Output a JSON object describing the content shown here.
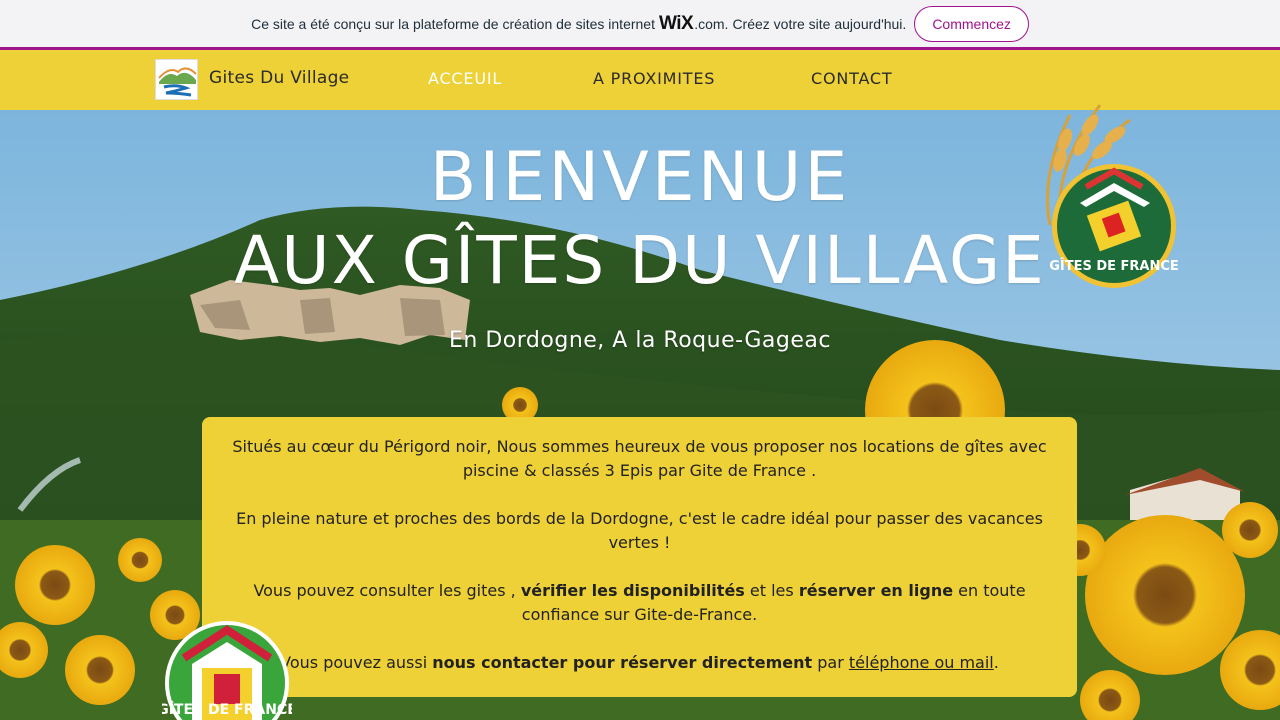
{
  "wix_banner": {
    "text_before": "Ce site a été conçu sur la plateforme de création de sites internet",
    "logo_text": "WiX",
    "logo_suffix": ".com.",
    "text_after": "Créez votre site aujourd'hui.",
    "button_label": "Commencez",
    "accent_color": "#a0138e"
  },
  "header": {
    "site_name": "Gites Du Village",
    "nav": [
      {
        "label": "ACCEUIL",
        "active": true
      },
      {
        "label": "A PROXIMITES",
        "active": false
      },
      {
        "label": "CONTACT",
        "active": false
      }
    ],
    "background_color": "#eed137"
  },
  "hero": {
    "title_line1": "BIENVENUE",
    "title_line2": "AUX GÎTES DU VILLAGE",
    "subtitle": "En Dordogne, A la Roque-Gageac"
  },
  "info": {
    "p1": "Situés au cœur du Périgord noir, Nous sommes heureux de vous proposer nos locations de gîtes avec piscine & classés 3 Epis par Gite de France .",
    "p2": "En pleine nature et proches des bords de la Dordogne, c'est le cadre idéal pour passer des vacances vertes !",
    "p3_a": "Vous pouvez consulter les gites ,",
    "p3_b": "vérifier les disponibilités",
    "p3_c": "et les",
    "p3_d": "réserver en ligne",
    "p3_e": "en toute confiance sur Gite-de-France.",
    "p4_a": "Vous pouvez aussi",
    "p4_b": "nous contacter pour réserver directement",
    "p4_c": "par",
    "p4_link": "téléphone ou mail",
    "p4_d": "."
  },
  "badges": {
    "top_text": "GÎTES DE FRANCE",
    "bottom_text": "GÎTES DE FRANCE"
  }
}
